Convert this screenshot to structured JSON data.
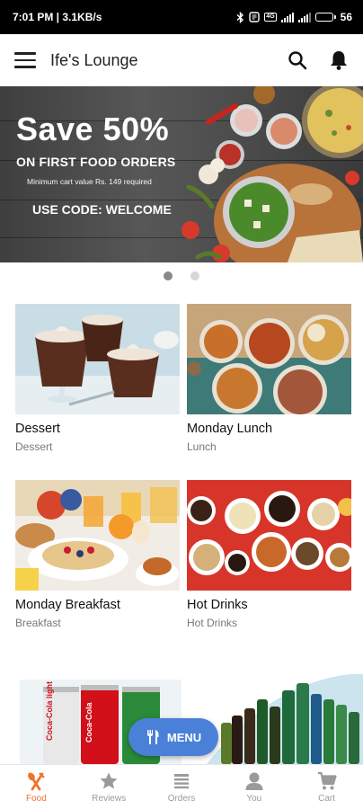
{
  "status_bar": {
    "time_speed": "7:01 PM | 3.1KB/s",
    "battery": "56",
    "battery_level": 0.56,
    "network_badge": "4G"
  },
  "app_bar": {
    "title": "Ife's Lounge"
  },
  "banner": {
    "headline": "Save 50%",
    "subline": "ON FIRST FOOD ORDERS",
    "min_note": "Minimum cart value Rs. 149 required",
    "code_line": "USE CODE: WELCOME"
  },
  "carousel": {
    "page_count": 2,
    "active_index": 0
  },
  "categories": [
    {
      "name": "Dessert",
      "sub": "Dessert"
    },
    {
      "name": "Monday Lunch",
      "sub": "Lunch"
    },
    {
      "name": "Monday Breakfast",
      "sub": "Breakfast"
    },
    {
      "name": "Hot Drinks",
      "sub": "Hot Drinks"
    }
  ],
  "promo": {
    "can_text": "Coca-Cola",
    "can_light_text": "light"
  },
  "fab": {
    "label": "MENU"
  },
  "bottom_nav": [
    {
      "label": "Food",
      "icon": "fork-knife-icon",
      "active": true
    },
    {
      "label": "Reviews",
      "icon": "star-icon",
      "active": false
    },
    {
      "label": "Orders",
      "icon": "list-icon",
      "active": false
    },
    {
      "label": "You",
      "icon": "person-icon",
      "active": false
    },
    {
      "label": "Cart",
      "icon": "cart-icon",
      "active": false
    }
  ],
  "colors": {
    "accent": "#f0722c",
    "fab": "#4a80d8",
    "status_bar": "#000000",
    "inactive": "#9a9a9a"
  }
}
